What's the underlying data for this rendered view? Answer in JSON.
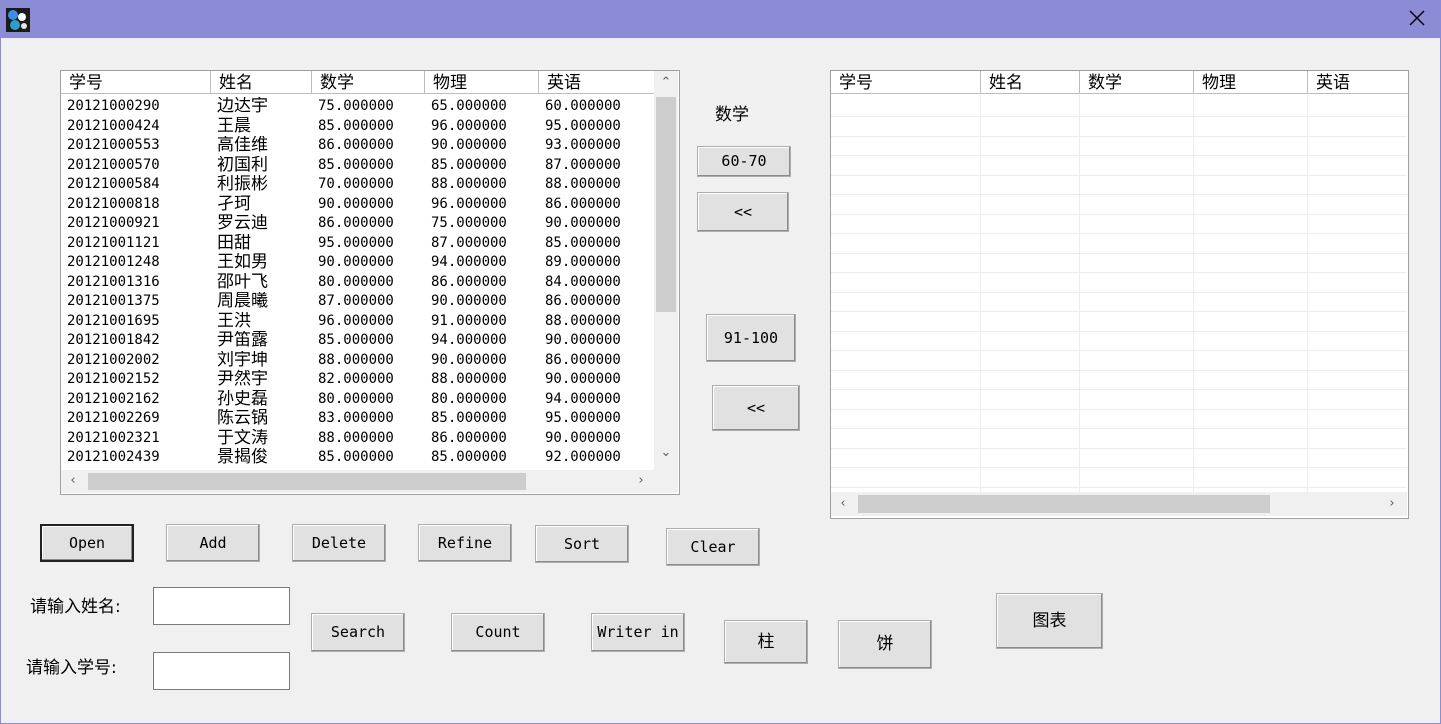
{
  "left_list": {
    "columns": [
      "学号",
      "姓名",
      "数学",
      "物理",
      "英语"
    ],
    "rows": [
      [
        "20121000290",
        "边达宇",
        "75.000000",
        "65.000000",
        "60.000000"
      ],
      [
        "20121000424",
        "王晨",
        "85.000000",
        "96.000000",
        "95.000000"
      ],
      [
        "20121000553",
        "高佳维",
        "86.000000",
        "90.000000",
        "93.000000"
      ],
      [
        "20121000570",
        "初国利",
        "85.000000",
        "85.000000",
        "87.000000"
      ],
      [
        "20121000584",
        "利振彬",
        "70.000000",
        "88.000000",
        "88.000000"
      ],
      [
        "20121000818",
        "孑珂",
        "90.000000",
        "96.000000",
        "86.000000"
      ],
      [
        "20121000921",
        "罗云迪",
        "86.000000",
        "75.000000",
        "90.000000"
      ],
      [
        "20121001121",
        "田甜",
        "95.000000",
        "87.000000",
        "85.000000"
      ],
      [
        "20121001248",
        "王如男",
        "90.000000",
        "94.000000",
        "89.000000"
      ],
      [
        "20121001316",
        "邵叶飞",
        "80.000000",
        "86.000000",
        "84.000000"
      ],
      [
        "20121001375",
        "周晨曦",
        "87.000000",
        "90.000000",
        "86.000000"
      ],
      [
        "20121001695",
        "王洪",
        "96.000000",
        "91.000000",
        "88.000000"
      ],
      [
        "20121001842",
        "尹笛露",
        "85.000000",
        "94.000000",
        "90.000000"
      ],
      [
        "20121002002",
        "刘宇坤",
        "88.000000",
        "90.000000",
        "86.000000"
      ],
      [
        "20121002152",
        "尹然宇",
        "82.000000",
        "88.000000",
        "90.000000"
      ],
      [
        "20121002162",
        "孙史磊",
        "80.000000",
        "80.000000",
        "94.000000"
      ],
      [
        "20121002269",
        "陈云锅",
        "83.000000",
        "85.000000",
        "95.000000"
      ],
      [
        "20121002321",
        "于文涛",
        "88.000000",
        "86.000000",
        "90.000000"
      ],
      [
        "20121002439",
        "景揭俊",
        "85.000000",
        "85.000000",
        "92.000000"
      ]
    ]
  },
  "right_list": {
    "columns": [
      "学号",
      "姓名",
      "数学",
      "物理",
      "英语"
    ]
  },
  "middle": {
    "subject_label": "数学",
    "range1_button": "60-70",
    "back1_button": "<<",
    "range2_button": "91-100",
    "back2_button": "<<"
  },
  "buttons": {
    "open": "Open",
    "add": "Add",
    "delete": "Delete",
    "refine": "Refine",
    "sort": "Sort",
    "clear": "Clear",
    "search": "Search",
    "count": "Count",
    "writer_in": "Writer in",
    "bar": "柱",
    "pie": "饼",
    "chart": "图表"
  },
  "form": {
    "name_label": "请输入姓名:",
    "id_label": "请输入学号:",
    "name_value": "",
    "id_value": ""
  },
  "icons": {
    "app": "app-icon",
    "close": "close-icon",
    "scroll_up": "chevron-up-icon",
    "scroll_down": "chevron-down-icon",
    "scroll_left": "chevron-left-icon",
    "scroll_right": "chevron-right-icon"
  },
  "colors": {
    "titlebar": "#8b8bd6",
    "window_bg": "#f0f0f0"
  }
}
